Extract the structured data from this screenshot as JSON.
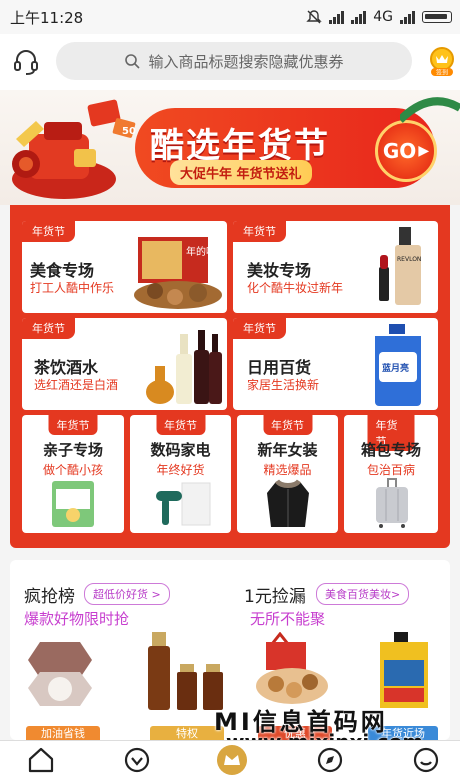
{
  "status_bar": {
    "time": "上午11:28",
    "network": "4G"
  },
  "search": {
    "placeholder": "输入商品标题搜索隐藏优惠券"
  },
  "coin_badge": "签到",
  "banner": {
    "title": "酷选年货节",
    "subtitle": "大促牛年 年货节送礼",
    "go_label": "GO",
    "deco_number": "50"
  },
  "tag_label": "年货节",
  "big_cards": [
    {
      "title": "美食专场",
      "subtitle": "打工人酷中作乐",
      "image_text": "年的味道"
    },
    {
      "title": "美妆专场",
      "subtitle": "化个酷牛妆过新年",
      "image_text": "REVLON"
    },
    {
      "title": "茶饮酒水",
      "subtitle": "选红酒还是白酒"
    },
    {
      "title": "日用百货",
      "subtitle": "家居生活换新",
      "image_text": "蓝月亮"
    }
  ],
  "small_cards": [
    {
      "title": "亲子专场",
      "subtitle": "做个酷小孩"
    },
    {
      "title": "数码家电",
      "subtitle": "年终好货"
    },
    {
      "title": "新年女装",
      "subtitle": "精选爆品"
    },
    {
      "title": "箱包专场",
      "subtitle": "包治百病"
    }
  ],
  "rush": {
    "title": "疯抢榜",
    "pill": "超低价好货 >",
    "subtitle": "爆款好物限时抢",
    "strips": [
      "加油省钱",
      "特权"
    ]
  },
  "bargain": {
    "title": "1元捡漏",
    "pill": "美食百货美妆>",
    "subtitle": "无所不能聚",
    "strips": [
      "优惠",
      "年货近场"
    ]
  },
  "watermark": {
    "line1": "MI信息首码网",
    "line2": "www.mixinxi.com"
  },
  "tabs": [
    "home",
    "discover",
    "crown",
    "compass",
    "profile"
  ]
}
